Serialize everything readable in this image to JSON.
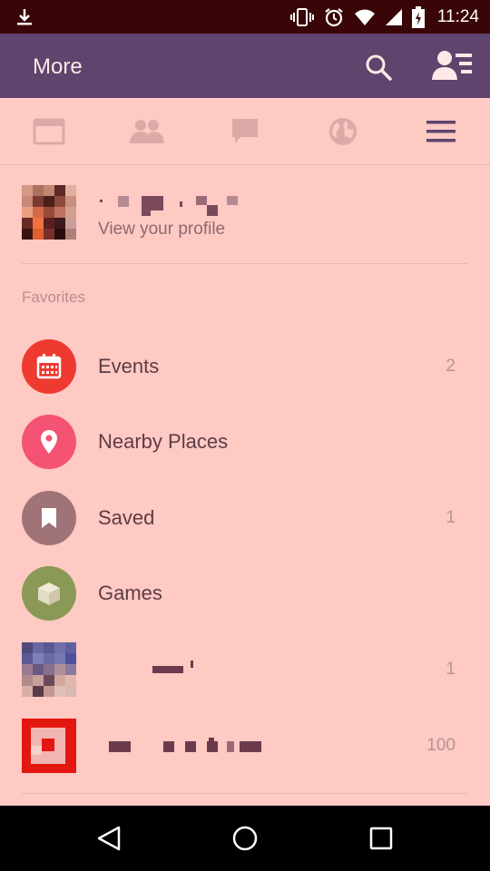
{
  "status_bar": {
    "time": "11:24",
    "icons": [
      "download-icon",
      "vibrate-icon",
      "alarm-icon",
      "wifi-icon",
      "signal-icon",
      "battery-charging-icon"
    ]
  },
  "app_bar": {
    "title": "More",
    "icons": [
      "search-icon",
      "profile-menu-icon"
    ]
  },
  "tabs": [
    {
      "name": "news-feed",
      "icon": "news-feed-icon",
      "active": false
    },
    {
      "name": "friends",
      "icon": "friends-icon",
      "active": false
    },
    {
      "name": "messages",
      "icon": "messages-icon",
      "active": false
    },
    {
      "name": "notifications",
      "icon": "globe-icon",
      "active": false
    },
    {
      "name": "more",
      "icon": "menu-icon",
      "active": true
    }
  ],
  "profile": {
    "subtitle": "View your profile"
  },
  "favorites": {
    "section_label": "Favorites",
    "items": [
      {
        "label": "Events",
        "count": "2",
        "icon": "calendar-icon",
        "color": "#ee3a31"
      },
      {
        "label": "Nearby Places",
        "count": "",
        "icon": "location-pin-icon",
        "color": "#f45374"
      },
      {
        "label": "Saved",
        "count": "1",
        "icon": "bookmark-icon",
        "color": "#9f7378"
      },
      {
        "label": "Games",
        "count": "",
        "icon": "cube-icon",
        "color": "#8a9a56"
      },
      {
        "label": "",
        "count": "1",
        "icon": "group-thumbnail",
        "color": ""
      },
      {
        "label": "",
        "count": "100",
        "icon": "page-thumbnail",
        "color": "#e31710"
      }
    ]
  },
  "colors": {
    "status_bar": "#3a0506",
    "app_bar": "#5f446d",
    "background": "#ffc9c4",
    "tab_icon": "#dcaaa6",
    "tab_icon_active": "#5f446d"
  },
  "nav_bar": {
    "icons": [
      "back-icon",
      "home-icon",
      "recents-icon"
    ]
  }
}
